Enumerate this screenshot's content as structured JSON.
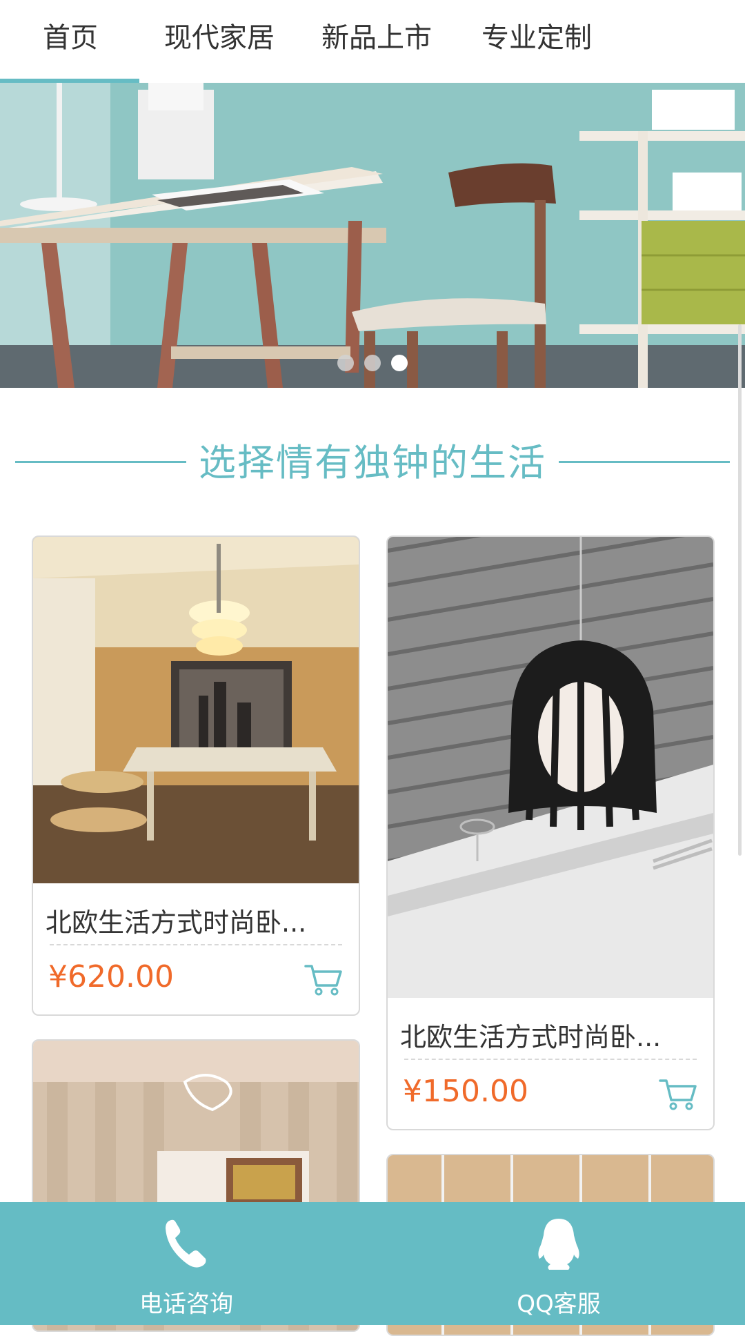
{
  "nav": {
    "items": [
      {
        "label": "首页"
      },
      {
        "label": "现代家居"
      },
      {
        "label": "新品上市"
      },
      {
        "label": "专业定制"
      }
    ],
    "active_index": 0,
    "accent_color": "#66bcc4"
  },
  "banner": {
    "slide_count": 3,
    "active_slide": 3
  },
  "section": {
    "title": "选择情有独钟的生活"
  },
  "products": [
    {
      "name": "北欧生活方式时尚卧...",
      "price": "¥620.00",
      "icon": "shopping-cart-icon"
    },
    {
      "name": "北欧生活方式时尚卧...",
      "price": "¥150.00",
      "icon": "shopping-cart-icon"
    }
  ],
  "bottom_bar": {
    "phone": {
      "label": "电话咨询",
      "icon": "phone-icon"
    },
    "qq": {
      "label": "QQ客服",
      "icon": "qq-penguin-icon"
    },
    "color": "#65bcc4"
  },
  "colors": {
    "accent": "#66bcc4",
    "price": "#f06a2a",
    "text": "#333333"
  }
}
